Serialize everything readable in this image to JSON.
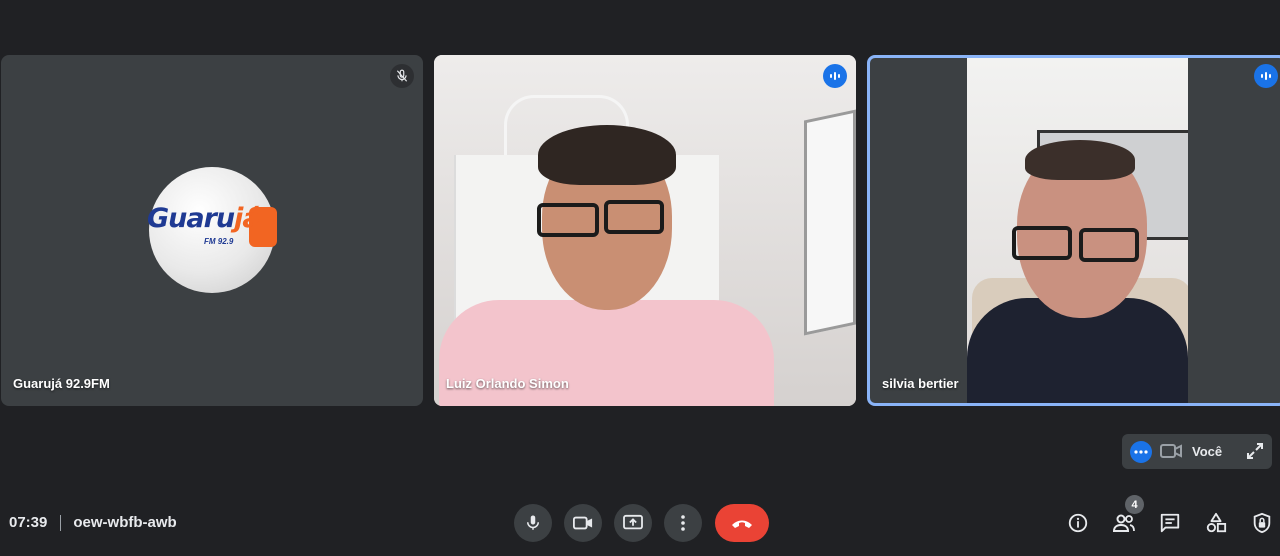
{
  "participants": [
    {
      "name": "Guarujá 92.9FM",
      "muted": true
    },
    {
      "name": "Luiz Orlando Simon",
      "speaking": true
    },
    {
      "name": "silvia bertier",
      "speaking": true
    }
  ],
  "logo": {
    "word_main": "Guaru",
    "word_accent": "já",
    "sub": "FM 92.9"
  },
  "self_view": {
    "label": "Você"
  },
  "meeting": {
    "time": "07:39",
    "code": "oew-wbfb-awb"
  },
  "people_count": "4",
  "colors": {
    "background": "#202124",
    "tile": "#3c4043",
    "accent": "#1a73e8",
    "leave": "#ea4335",
    "active_border": "#8ab4f8"
  },
  "icons": [
    "mic-off-icon",
    "speaking-icon",
    "more-dots-icon",
    "camera-icon",
    "expand-icon",
    "mic-icon",
    "present-icon",
    "more-vert-icon",
    "hang-up-icon",
    "info-icon",
    "people-icon",
    "chat-icon",
    "activities-icon",
    "host-controls-icon"
  ]
}
